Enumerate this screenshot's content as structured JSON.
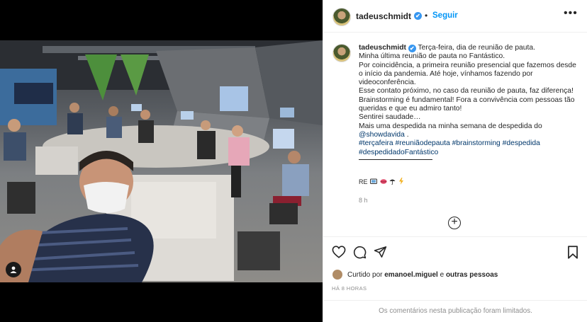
{
  "post": {
    "username": "tadeuschmidt",
    "verified_mark": "✔",
    "separator": "•",
    "follow_label": "Seguir",
    "more_label": "•••",
    "caption_lines": [
      "Terça-feira, dia de reunião de pauta.",
      "Minha última reunião de pauta no Fantástico.",
      "Por coincidência, a primeira reunião presencial que fazemos desde",
      "o início da pandemia. Até hoje, vínhamos fazendo por",
      "videoconferência.",
      "Esse contato próximo, no caso da reunião de pauta, faz diferença!",
      "Brainstorming é fundamental! Fora a convivência com pessoas tão",
      "queridas e que eu admiro tanto!",
      "Sentirei saudade…",
      "Mais uma despedida na minha semana de despedida do"
    ],
    "mention": "@showdavida",
    "mention_suffix": " .",
    "hashtags_line1": "#terçafeira #reuniãodepauta #brainstorming #despedida",
    "hashtags_line2": "#despedidadoFantástico",
    "emoji_prefix": "RE",
    "emoji_icons": [
      "tv-icon",
      "lips-icon",
      "umbrella-icon",
      "lightning-icon"
    ],
    "relative_time": "8 h",
    "liked_by_prefix": "Curtido por",
    "liked_by_user": "emanoel.miguel",
    "liked_by_conj": "e",
    "liked_by_others": "outras pessoas",
    "posted_ago": "HÁ 8 HORAS",
    "comments_limited": "Os comentários nesta publicação foram limitados."
  },
  "colors": {
    "link_blue": "#0095f6",
    "verified_blue": "#3897f0",
    "hashtag": "#00376b",
    "muted": "#8e8e8e",
    "text": "#262626"
  }
}
